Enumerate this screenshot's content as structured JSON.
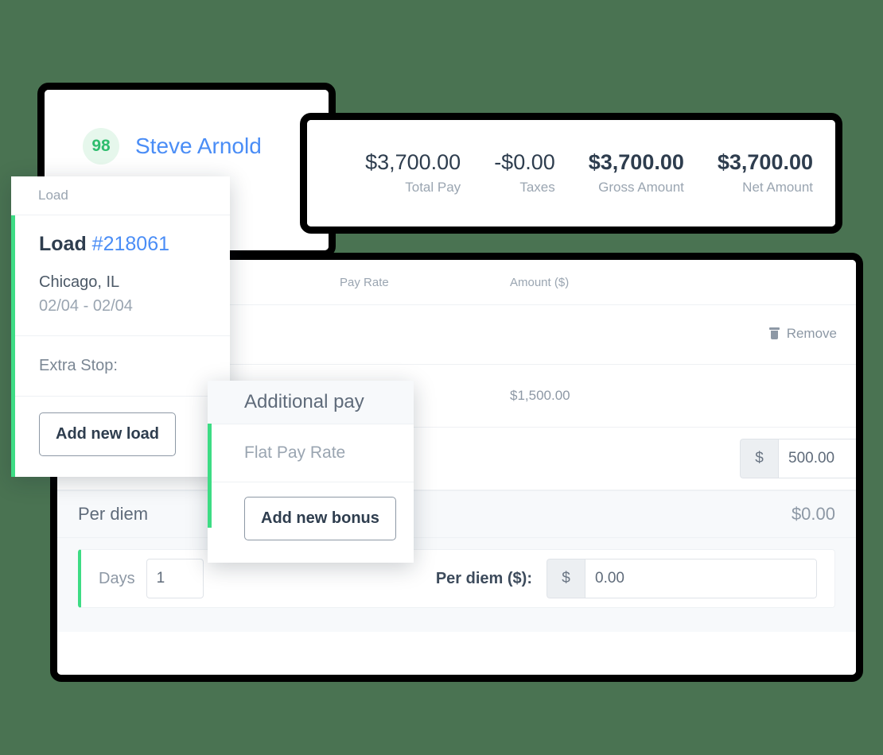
{
  "driver": {
    "badge_count": "98",
    "name": "Steve Arnold"
  },
  "summary": {
    "stats": [
      {
        "value": "$3,700.00",
        "label": "Total Pay",
        "bold": false
      },
      {
        "value": "-$0.00",
        "label": "Taxes",
        "bold": false
      },
      {
        "value": "$3,700.00",
        "label": "Gross Amount",
        "bold": true
      },
      {
        "value": "$3,700.00",
        "label": "Net Amount",
        "bold": true
      }
    ]
  },
  "table": {
    "headers": {
      "pay_rate": "Pay Rate",
      "amount": "Amount ($)"
    },
    "rows": [
      {
        "remove_label": "Remove",
        "amount": ""
      },
      {
        "remove_label": "",
        "amount": "$1,500.00"
      }
    ],
    "bonus_input": {
      "currency_symbol": "$",
      "value": "500.00"
    }
  },
  "per_diem": {
    "title": "Per diem",
    "total": "$0.00",
    "days_label": "Days",
    "days_value": "1",
    "amount_label": "Per diem ($):",
    "currency_symbol": "$",
    "amount_value": "0.00"
  },
  "load_card": {
    "header": "Load",
    "title_prefix": "Load",
    "load_number": "#218061",
    "city": "Chicago, IL",
    "dates": "02/04 - 02/04",
    "extra_stop_label": "Extra Stop:",
    "add_button": "Add new load"
  },
  "additional_pay_card": {
    "header": "Additional pay",
    "rate_label": "Flat Pay Rate",
    "add_button": "Add new bonus"
  },
  "colors": {
    "background": "#4a7352",
    "accent_green": "#3ddc84",
    "link_blue": "#4a8df6",
    "badge_green": "#2fbd6e",
    "frame_black": "#000000"
  }
}
